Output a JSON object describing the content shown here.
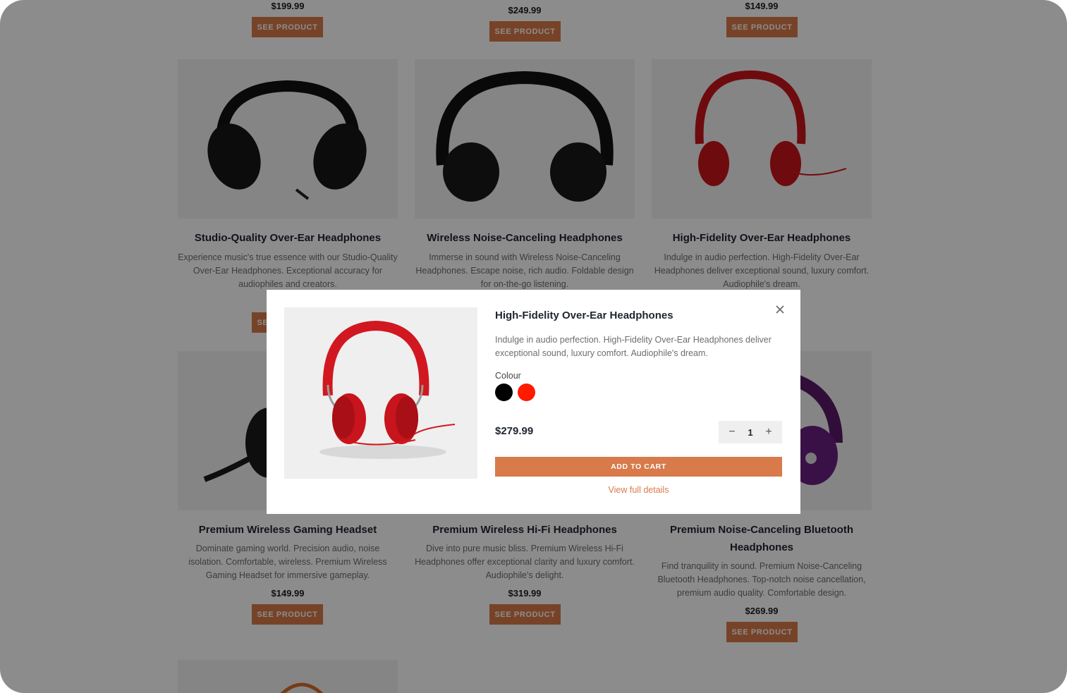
{
  "colors": {
    "accent": "#d97a4a",
    "swatch_black": "#000000",
    "swatch_red": "#ff1a00"
  },
  "top_row": {
    "prices": [
      "$199.99",
      "$249.99",
      "$149.99"
    ],
    "button_label": "SEE PRODUCT"
  },
  "products": [
    {
      "title": "Studio-Quality Over-Ear Headphones",
      "description": "Experience music's true essence with our Studio-Quality Over-Ear Headphones. Exceptional accuracy for audiophiles and creators.",
      "image": "black-over-ear-headphones-image"
    },
    {
      "title": "Wireless Noise-Canceling Headphones",
      "description": "Immerse in sound with Wireless Noise-Canceling Headphones. Escape noise, rich audio. Foldable design for on-the-go listening.",
      "image": "black-wireless-headphones-image"
    },
    {
      "title": "High-Fidelity Over-Ear Headphones",
      "description": "Indulge in audio perfection. High-Fidelity Over-Ear Headphones deliver exceptional sound, luxury comfort. Audiophile's dream.",
      "image": "red-headphones-image"
    },
    {
      "title": "Premium Wireless Gaming Headset",
      "description": "Dominate gaming world. Precision audio, noise isolation. Comfortable, wireless. Premium Wireless Gaming Headset for immersive gameplay.",
      "price": "$149.99",
      "image": "gaming-headset-image"
    },
    {
      "title": "Premium Wireless Hi-Fi Headphones",
      "description": "Dive into pure music bliss. Premium Wireless Hi-Fi Headphones offer exceptional clarity and luxury comfort. Audiophile's delight.",
      "price": "$319.99",
      "image": "hifi-headphones-image"
    },
    {
      "title_line1": "Premium Noise-Canceling Bluetooth",
      "title_line2": "Headphones",
      "description": "Find tranquility in sound. Premium Noise-Canceling Bluetooth Headphones. Top-notch noise cancellation, premium audio quality. Comfortable design.",
      "price": "$269.99",
      "image": "purple-headphones-image"
    }
  ],
  "modal": {
    "title": "High-Fidelity Over-Ear Headphones",
    "description": "Indulge in audio perfection. High-Fidelity Over-Ear Headphones deliver exceptional sound, luxury comfort. Audiophile's dream.",
    "colour_label": "Colour",
    "colours": [
      "black",
      "red"
    ],
    "price": "$279.99",
    "quantity": "1",
    "add_to_cart": "ADD TO CART",
    "view_details": "View full details",
    "minus": "−",
    "plus": "+"
  }
}
